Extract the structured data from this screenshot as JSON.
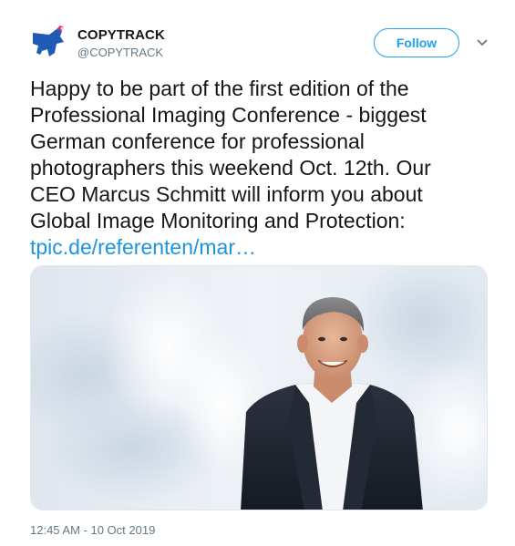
{
  "account": {
    "display_name": "COPYTRACK",
    "handle": "@COPYTRACK",
    "avatar_icon": "copytrack-logo-icon",
    "brand_color": "#1f5bb5"
  },
  "actions": {
    "follow_label": "Follow",
    "menu_icon": "chevron-down-icon"
  },
  "tweet": {
    "lines": [
      "Happy to be part of the first edition of the",
      "Professional Imaging Conference - biggest",
      "German conference for professional",
      "photographers this weekend Oct. 12th. Our",
      "CEO Marcus Schmitt will inform you about",
      "Global Image Monitoring and Protection:"
    ],
    "link_text": "tpic.de/referenten/mar…",
    "link_color": "#1b95e0"
  },
  "media": {
    "icon": "photo-portrait"
  },
  "meta": {
    "timestamp": "12:45 AM - 10 Oct 2019"
  }
}
